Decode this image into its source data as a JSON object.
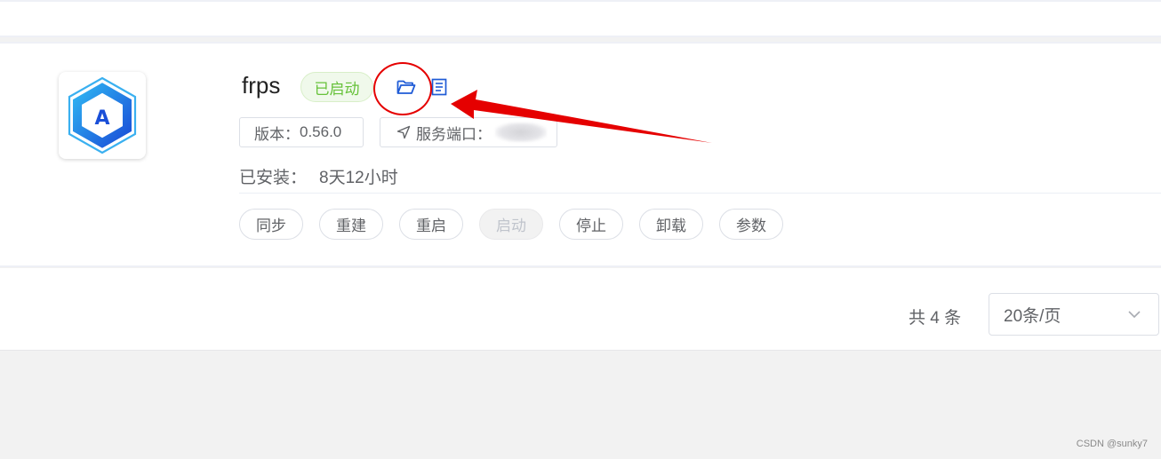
{
  "app": {
    "name": "frps",
    "status": "已启动",
    "version_label": "版本：",
    "version_value": "0.56.0",
    "port_label": "服务端口：",
    "installed_label": "已安装：",
    "installed_value": "8天12小时",
    "icon_letter": "A"
  },
  "actions": [
    {
      "label": "同步",
      "disabled": false
    },
    {
      "label": "重建",
      "disabled": false
    },
    {
      "label": "重启",
      "disabled": false
    },
    {
      "label": "启动",
      "disabled": true
    },
    {
      "label": "停止",
      "disabled": false
    },
    {
      "label": "卸载",
      "disabled": false
    },
    {
      "label": "参数",
      "disabled": false
    }
  ],
  "pagination": {
    "total": "共 4 条",
    "page_size": "20条/页"
  },
  "watermark": "CSDN @sunky7",
  "colors": {
    "accent": "#1f5bd6",
    "status_green": "#67c23a",
    "annotation_red": "#e50000"
  }
}
